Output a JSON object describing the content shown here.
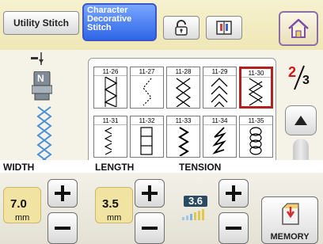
{
  "header": {
    "utility_tab": "Utility Stitch",
    "character_tab_lines": [
      "Character",
      "Decorative",
      "Stitch"
    ]
  },
  "icons": {
    "lock": "lock-icon",
    "book": "book-icon",
    "home": "home-icon",
    "needle": "needle-icon",
    "foot": "presser-foot-icon",
    "preview": "stitch-preview-icon",
    "memory": "memory-icon"
  },
  "presser_foot_letter": "N",
  "stitches": [
    {
      "num": "11-26",
      "selected": false
    },
    {
      "num": "11-27",
      "selected": false
    },
    {
      "num": "11-28",
      "selected": false
    },
    {
      "num": "11-29",
      "selected": false
    },
    {
      "num": "11-30",
      "selected": true
    },
    {
      "num": "11-31",
      "selected": false
    },
    {
      "num": "11-32",
      "selected": false
    },
    {
      "num": "11-33",
      "selected": false
    },
    {
      "num": "11-34",
      "selected": false
    },
    {
      "num": "11-35",
      "selected": false
    }
  ],
  "pager": {
    "current": "2",
    "total": "3"
  },
  "labels": {
    "width": "WIDTH",
    "length": "LENGTH",
    "tension": "TENSION"
  },
  "width": {
    "value": "7.0",
    "unit": "mm"
  },
  "length": {
    "value": "3.5",
    "unit": "mm"
  },
  "tension": {
    "value": "3.6"
  },
  "memory_label": "MEMORY",
  "colors": {
    "accent_blue": "#2f66e6",
    "selected_red": "#b42020",
    "value_yellow": "#f1e3a2",
    "home_border": "#8d6fa8"
  }
}
